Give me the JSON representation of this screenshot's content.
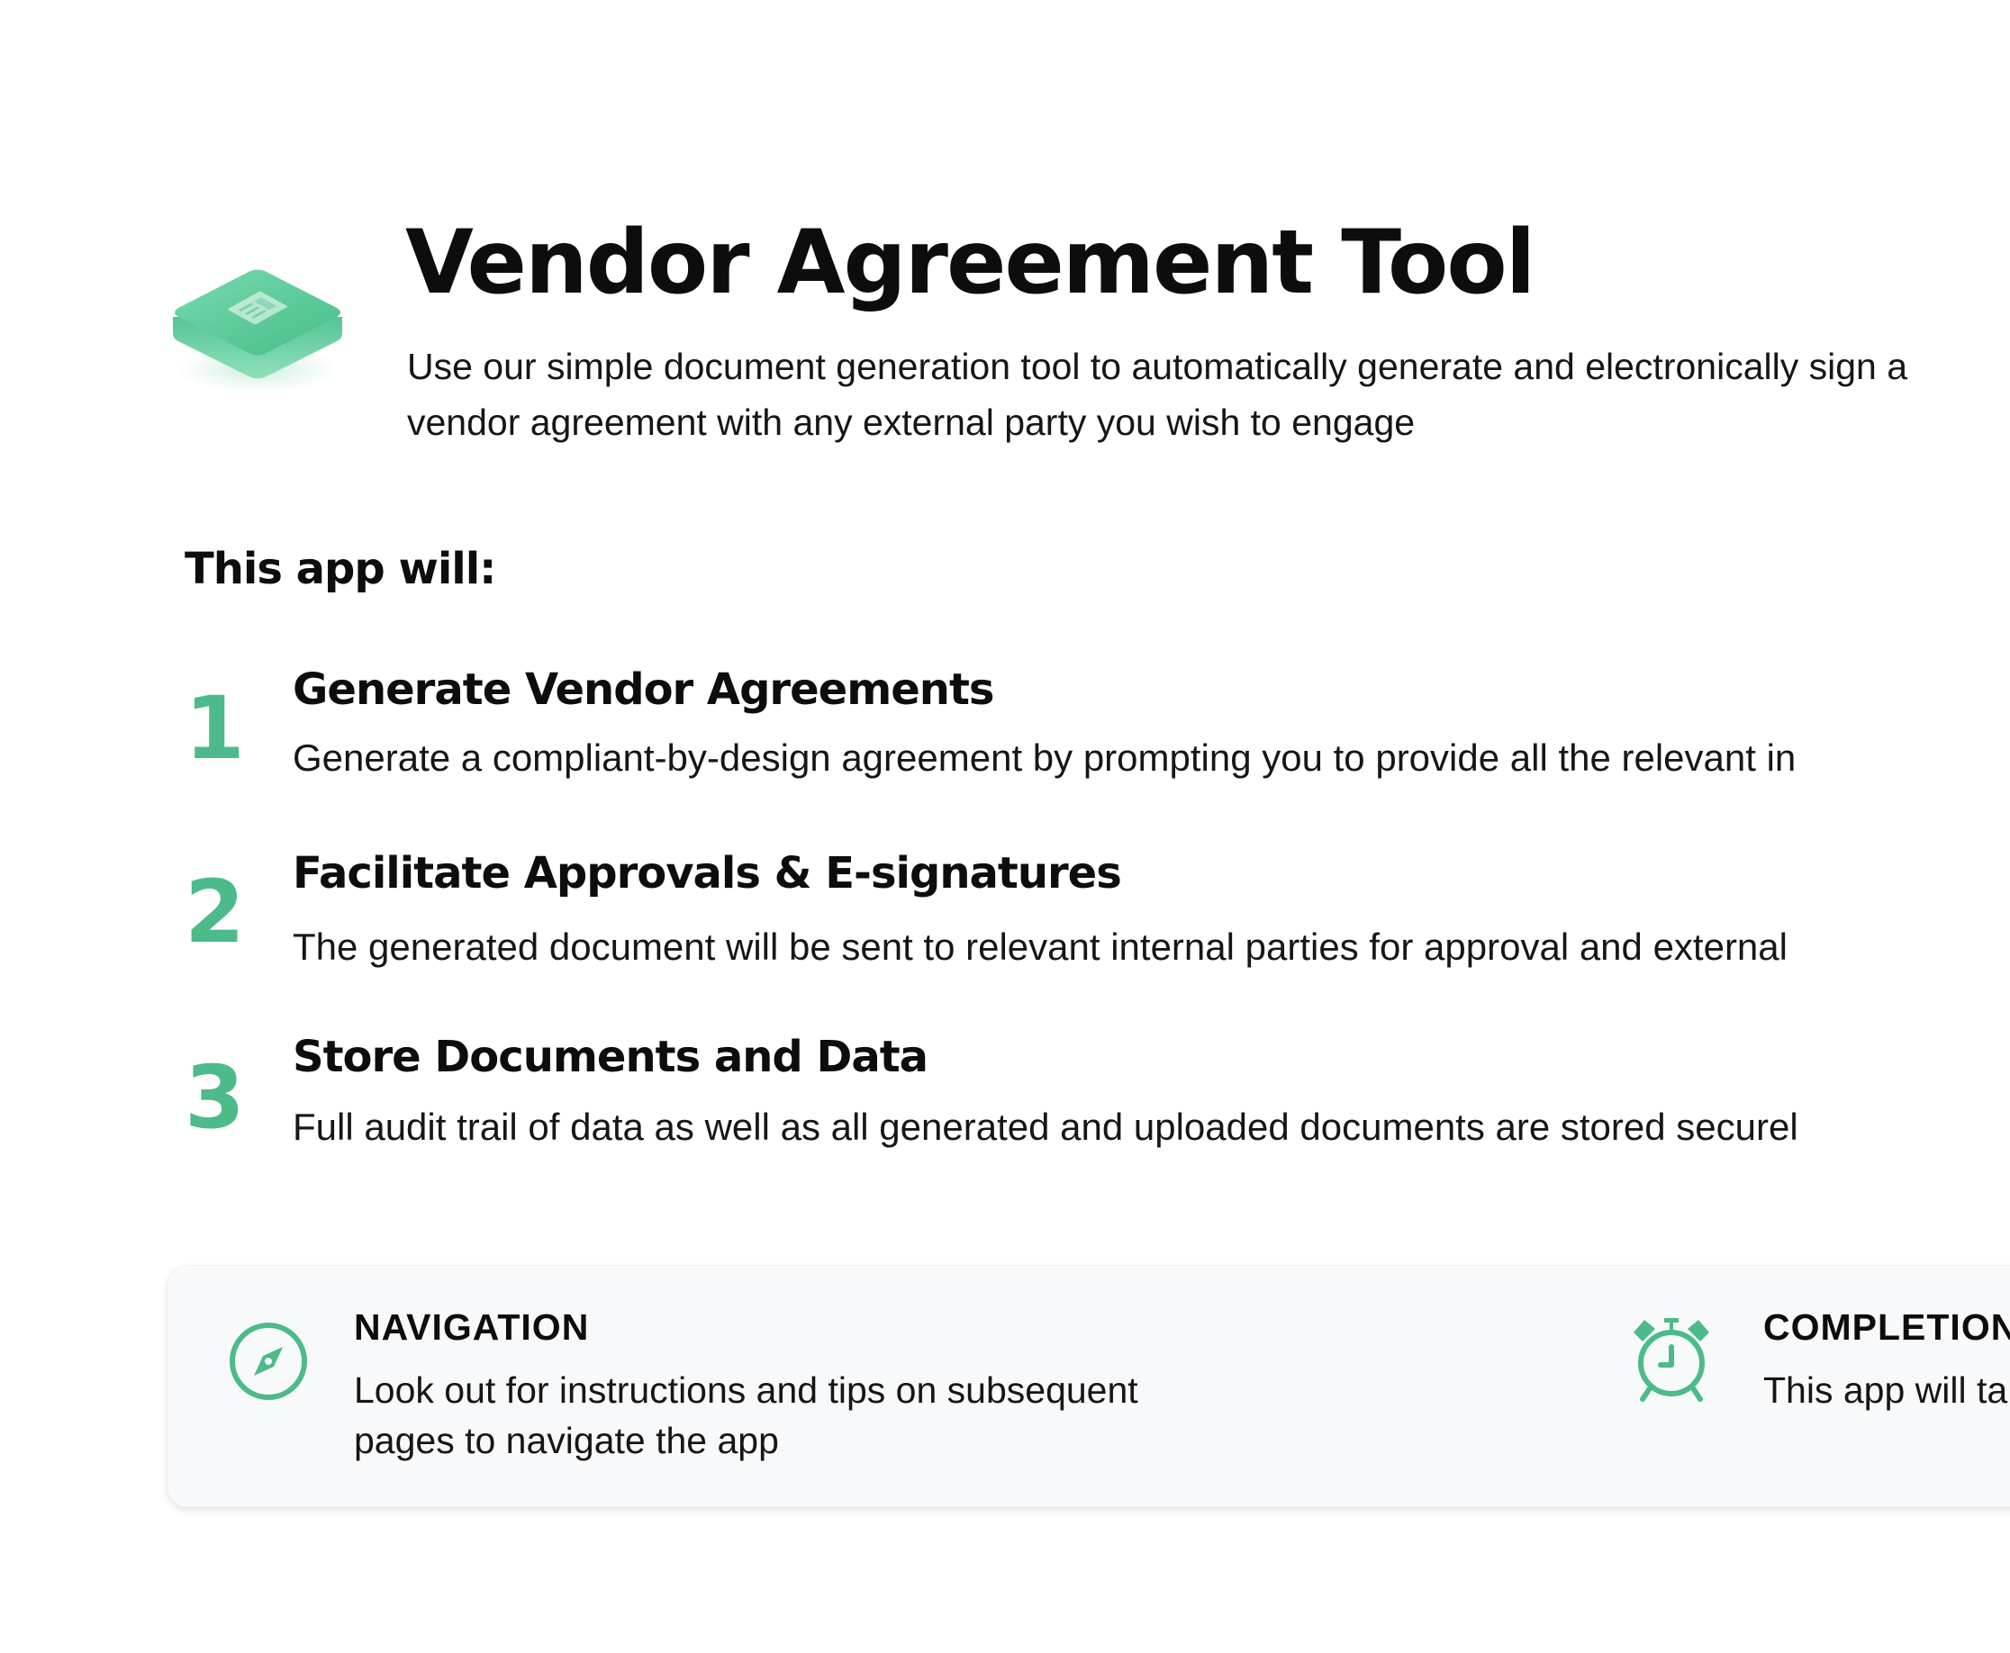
{
  "header": {
    "logo_icon": "document-tile-icon",
    "title": "Vendor Agreement Tool",
    "subtitle": "Use our simple document generation tool to automatically generate and electronically sign a vendor agreement with any external party you wish to engage"
  },
  "section": {
    "heading": "This app will:"
  },
  "steps": [
    {
      "number": "1",
      "title": "Generate Vendor Agreements",
      "description": "Generate a compliant-by-design agreement by prompting you to provide all the relevant in"
    },
    {
      "number": "2",
      "title": "Facilitate Approvals & E-signatures",
      "description": "The generated document will be sent to relevant internal parties for approval and external"
    },
    {
      "number": "3",
      "title": "Store Documents and Data",
      "description": "Full audit trail of data as well as all generated and uploaded documents are stored securel"
    }
  ],
  "info": {
    "navigation": {
      "icon": "compass-icon",
      "title": "NAVIGATION",
      "description": "Look out for instructions and tips on subsequent pages to navigate the app"
    },
    "completion": {
      "icon": "alarm-clock-icon",
      "title": "COMPLETION",
      "description": "This app will ta"
    }
  },
  "colors": {
    "accent": "#4cbb89",
    "card_background": "#f8f9fb",
    "text": "#111111"
  }
}
